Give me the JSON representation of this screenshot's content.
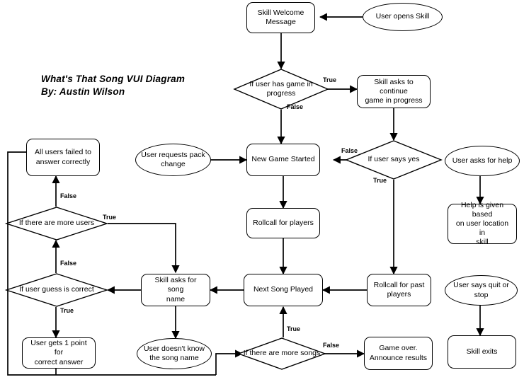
{
  "title": {
    "line1": "What's That Song VUI Diagram",
    "line2": "By: Austin Wilson"
  },
  "colors": {
    "stroke": "#000000",
    "fill": "#ffffff",
    "text": "#000000"
  },
  "nodes": {
    "user_opens_skill": "User opens Skill",
    "skill_welcome_message": "Skill Welcome\nMessage",
    "if_user_has_game_in_progress": "If user has game in\nprogress",
    "skill_asks_to_continue": "Skill asks to continue\ngame in progress",
    "if_user_says_yes": "If user says yes",
    "user_asks_for_help": "User asks for help",
    "help_is_given": "Help is given based\non user location in\nskill",
    "all_users_failed": "All users failed to\nanswer correctly",
    "user_requests_pack_change": "User requests pack\nchange",
    "new_game_started": "New Game Started",
    "if_there_are_more_users": "If there are more users",
    "rollcall_for_players": "Rollcall for players",
    "if_user_guess_is_correct": "If user guess is correct",
    "skill_asks_for_song_name": "Skill asks for song\nname",
    "next_song_played": "Next Song Played",
    "rollcall_for_past_players": "Rollcall for past\nplayers",
    "user_says_quit_or_stop": "User says quit or\nstop",
    "user_gets_point": "User gets 1 point for\ncorrect answer",
    "user_doesnt_know": "User doesn't know\nthe song name",
    "if_there_are_more_songs": "If there are more songs",
    "game_over": "Game over.\nAnnounce results",
    "skill_exits": "Skill exits"
  },
  "edge_labels": {
    "has_game_true": "True",
    "has_game_false": "False",
    "says_yes_false": "False",
    "says_yes_true": "True",
    "more_users_false": "False",
    "more_users_true": "True",
    "guess_correct_false": "False",
    "guess_correct_true": "True",
    "more_songs_true": "True",
    "more_songs_false": "False"
  }
}
